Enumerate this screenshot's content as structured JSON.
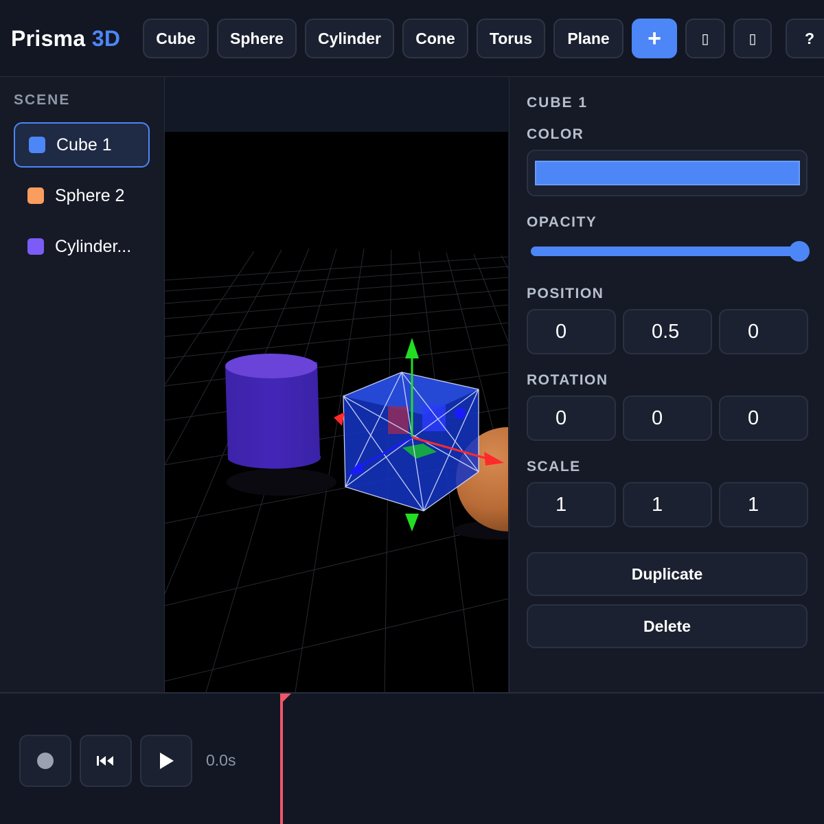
{
  "app": {
    "name": "Prisma",
    "name_accent": "3D"
  },
  "toolbar": {
    "primitives": [
      "Cube",
      "Sphere",
      "Cylinder",
      "Cone",
      "Torus",
      "Plane"
    ],
    "add_label": "+",
    "icon_glyph_1": "▯",
    "icon_glyph_2": "▯",
    "help_label": "?"
  },
  "scene": {
    "heading": "SCENE",
    "items": [
      {
        "label": "Cube 1",
        "color": "#4d86f7",
        "selected": true
      },
      {
        "label": "Sphere 2",
        "color": "#fb9d5e",
        "selected": false
      },
      {
        "label": "Cylinder...",
        "color": "#7c5cf6",
        "selected": false
      }
    ]
  },
  "properties": {
    "title": "CUBE 1",
    "color_label": "COLOR",
    "color_value": "#4d86f7",
    "opacity_label": "OPACITY",
    "opacity": 1.0,
    "position_label": "POSITION",
    "position": [
      "0",
      "0.5",
      "0"
    ],
    "rotation_label": "ROTATION",
    "rotation": [
      "0",
      "0",
      "0"
    ],
    "scale_label": "SCALE",
    "scale": [
      "1",
      "1",
      "1"
    ],
    "duplicate_label": "Duplicate",
    "delete_label": "Delete"
  },
  "timeline": {
    "time": "0.0s",
    "controls": [
      "record-icon",
      "rewind-icon",
      "play-icon"
    ]
  },
  "colors": {
    "accent": "#4d86f7",
    "playhead": "#f0566a",
    "gizmo_x": "#ff2a2a",
    "gizmo_y": "#22dd22",
    "gizmo_z": "#1a1aff"
  }
}
